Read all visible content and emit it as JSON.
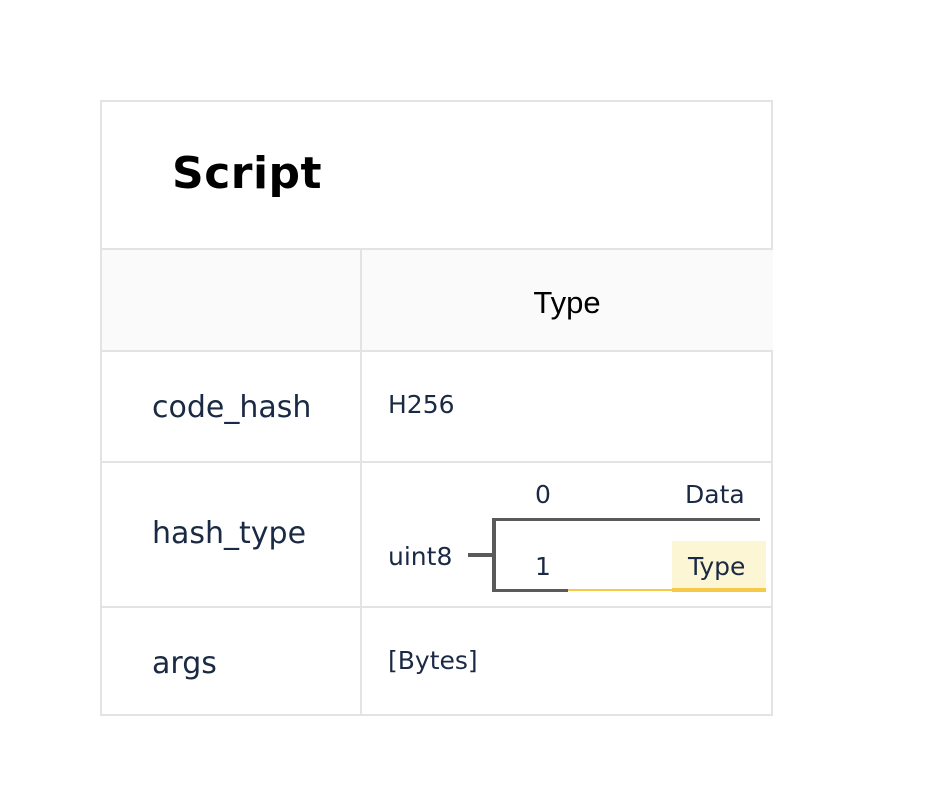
{
  "title": "Script",
  "column_header": "Type",
  "rows": [
    {
      "field": "code_hash",
      "type": "H256"
    },
    {
      "field": "hash_type",
      "type": "uint8"
    },
    {
      "field": "args",
      "type": "[Bytes]"
    }
  ],
  "hash_type_options": [
    {
      "value": "0",
      "label": "Data",
      "highlighted": false
    },
    {
      "value": "1",
      "label": "Type",
      "highlighted": true
    }
  ],
  "colors": {
    "border": "#e3e3e3",
    "text": "#1b2a44",
    "bracket": "#5a5a5a",
    "highlight_bg": "#fdf6d4",
    "highlight_line": "#f7c948"
  }
}
